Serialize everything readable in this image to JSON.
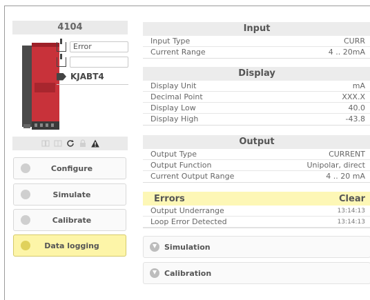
{
  "device": {
    "title": "4104",
    "status_value": "Error",
    "second_value": "",
    "tag": "KJABT4"
  },
  "left_buttons": [
    {
      "label": "Configure",
      "icon": "gear-icon"
    },
    {
      "label": "Simulate",
      "icon": "eye-icon"
    },
    {
      "label": "Calibrate",
      "icon": "wrench-icon"
    },
    {
      "label": "Data logging",
      "icon": "log-icon"
    }
  ],
  "input": {
    "title": "Input",
    "rows": [
      {
        "label": "Input Type",
        "value": "CURR"
      },
      {
        "label": "Current Range",
        "value": "4 .. 20mA"
      }
    ]
  },
  "display": {
    "title": "Display",
    "rows": [
      {
        "label": "Display Unit",
        "value": "mA"
      },
      {
        "label": "Decimal Point",
        "value": "XXX.X"
      },
      {
        "label": "Display Low",
        "value": "40.0"
      },
      {
        "label": "Display High",
        "value": "-43.8"
      }
    ]
  },
  "output": {
    "title": "Output",
    "rows": [
      {
        "label": "Output Type",
        "value": "CURRENT"
      },
      {
        "label": "Output Function",
        "value": "Unipolar, direct"
      },
      {
        "label": "Current Output Range",
        "value": "4 .. 20 mA"
      }
    ]
  },
  "errors": {
    "title": "Errors",
    "clear_label": "Clear",
    "rows": [
      {
        "label": "Output Underrange",
        "time": "13:14:13"
      },
      {
        "label": "Loop Error Detected",
        "time": "13:14:13"
      }
    ]
  },
  "sections": {
    "simulation": "Simulation",
    "calibration": "Calibration"
  },
  "colors": {
    "active_button": "#fdf5a8",
    "errors_header": "#fdf7b6",
    "device_red": "#c8323a"
  }
}
